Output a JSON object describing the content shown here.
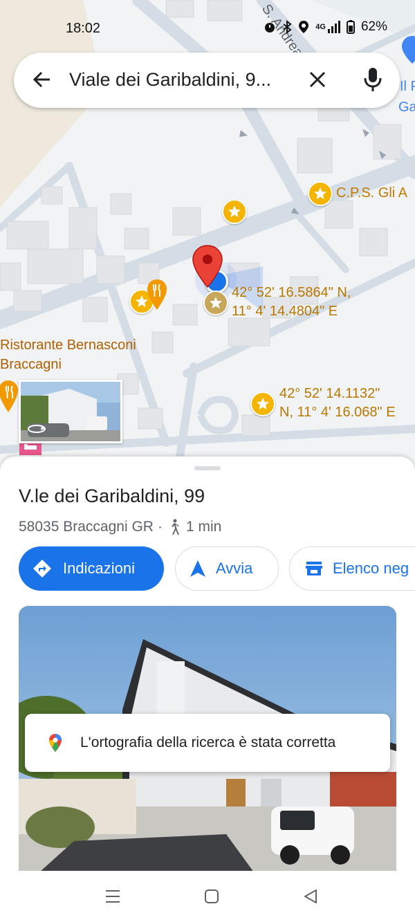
{
  "status_bar": {
    "time": "18:02",
    "network": "4G",
    "battery": "62%"
  },
  "search": {
    "query": "Viale dei Garibaldini, 9..."
  },
  "map": {
    "labels": {
      "street": "S. Andrea",
      "poi_cps": "C.P.S. Gli A",
      "poi_top_right": "Il P",
      "poi_top_right_2": "Ga",
      "restaurant": "Ristorante Bernasconi",
      "restaurant_2": "Braccagni"
    },
    "coords": [
      {
        "lat": "42° 52' 16.5864\" N,",
        "lon": "11° 4' 14.4804\" E"
      },
      {
        "lat": "42° 52' 14.1132\"",
        "lon": "N, 11° 4' 16.068\" E"
      }
    ]
  },
  "place": {
    "title": "V.le dei Garibaldini, 99",
    "address": "58035 Braccagni GR",
    "separator": "·",
    "walk_time": "1 min"
  },
  "actions": {
    "directions": "Indicazioni",
    "start": "Avvia",
    "list": "Elenco neg"
  },
  "toast": {
    "message": "L'ortografia della ricerca è stata corretta"
  },
  "colors": {
    "accent": "#1a73e8",
    "poi": "#f4b400",
    "pin": "#ea4335",
    "label": "#b06000"
  }
}
